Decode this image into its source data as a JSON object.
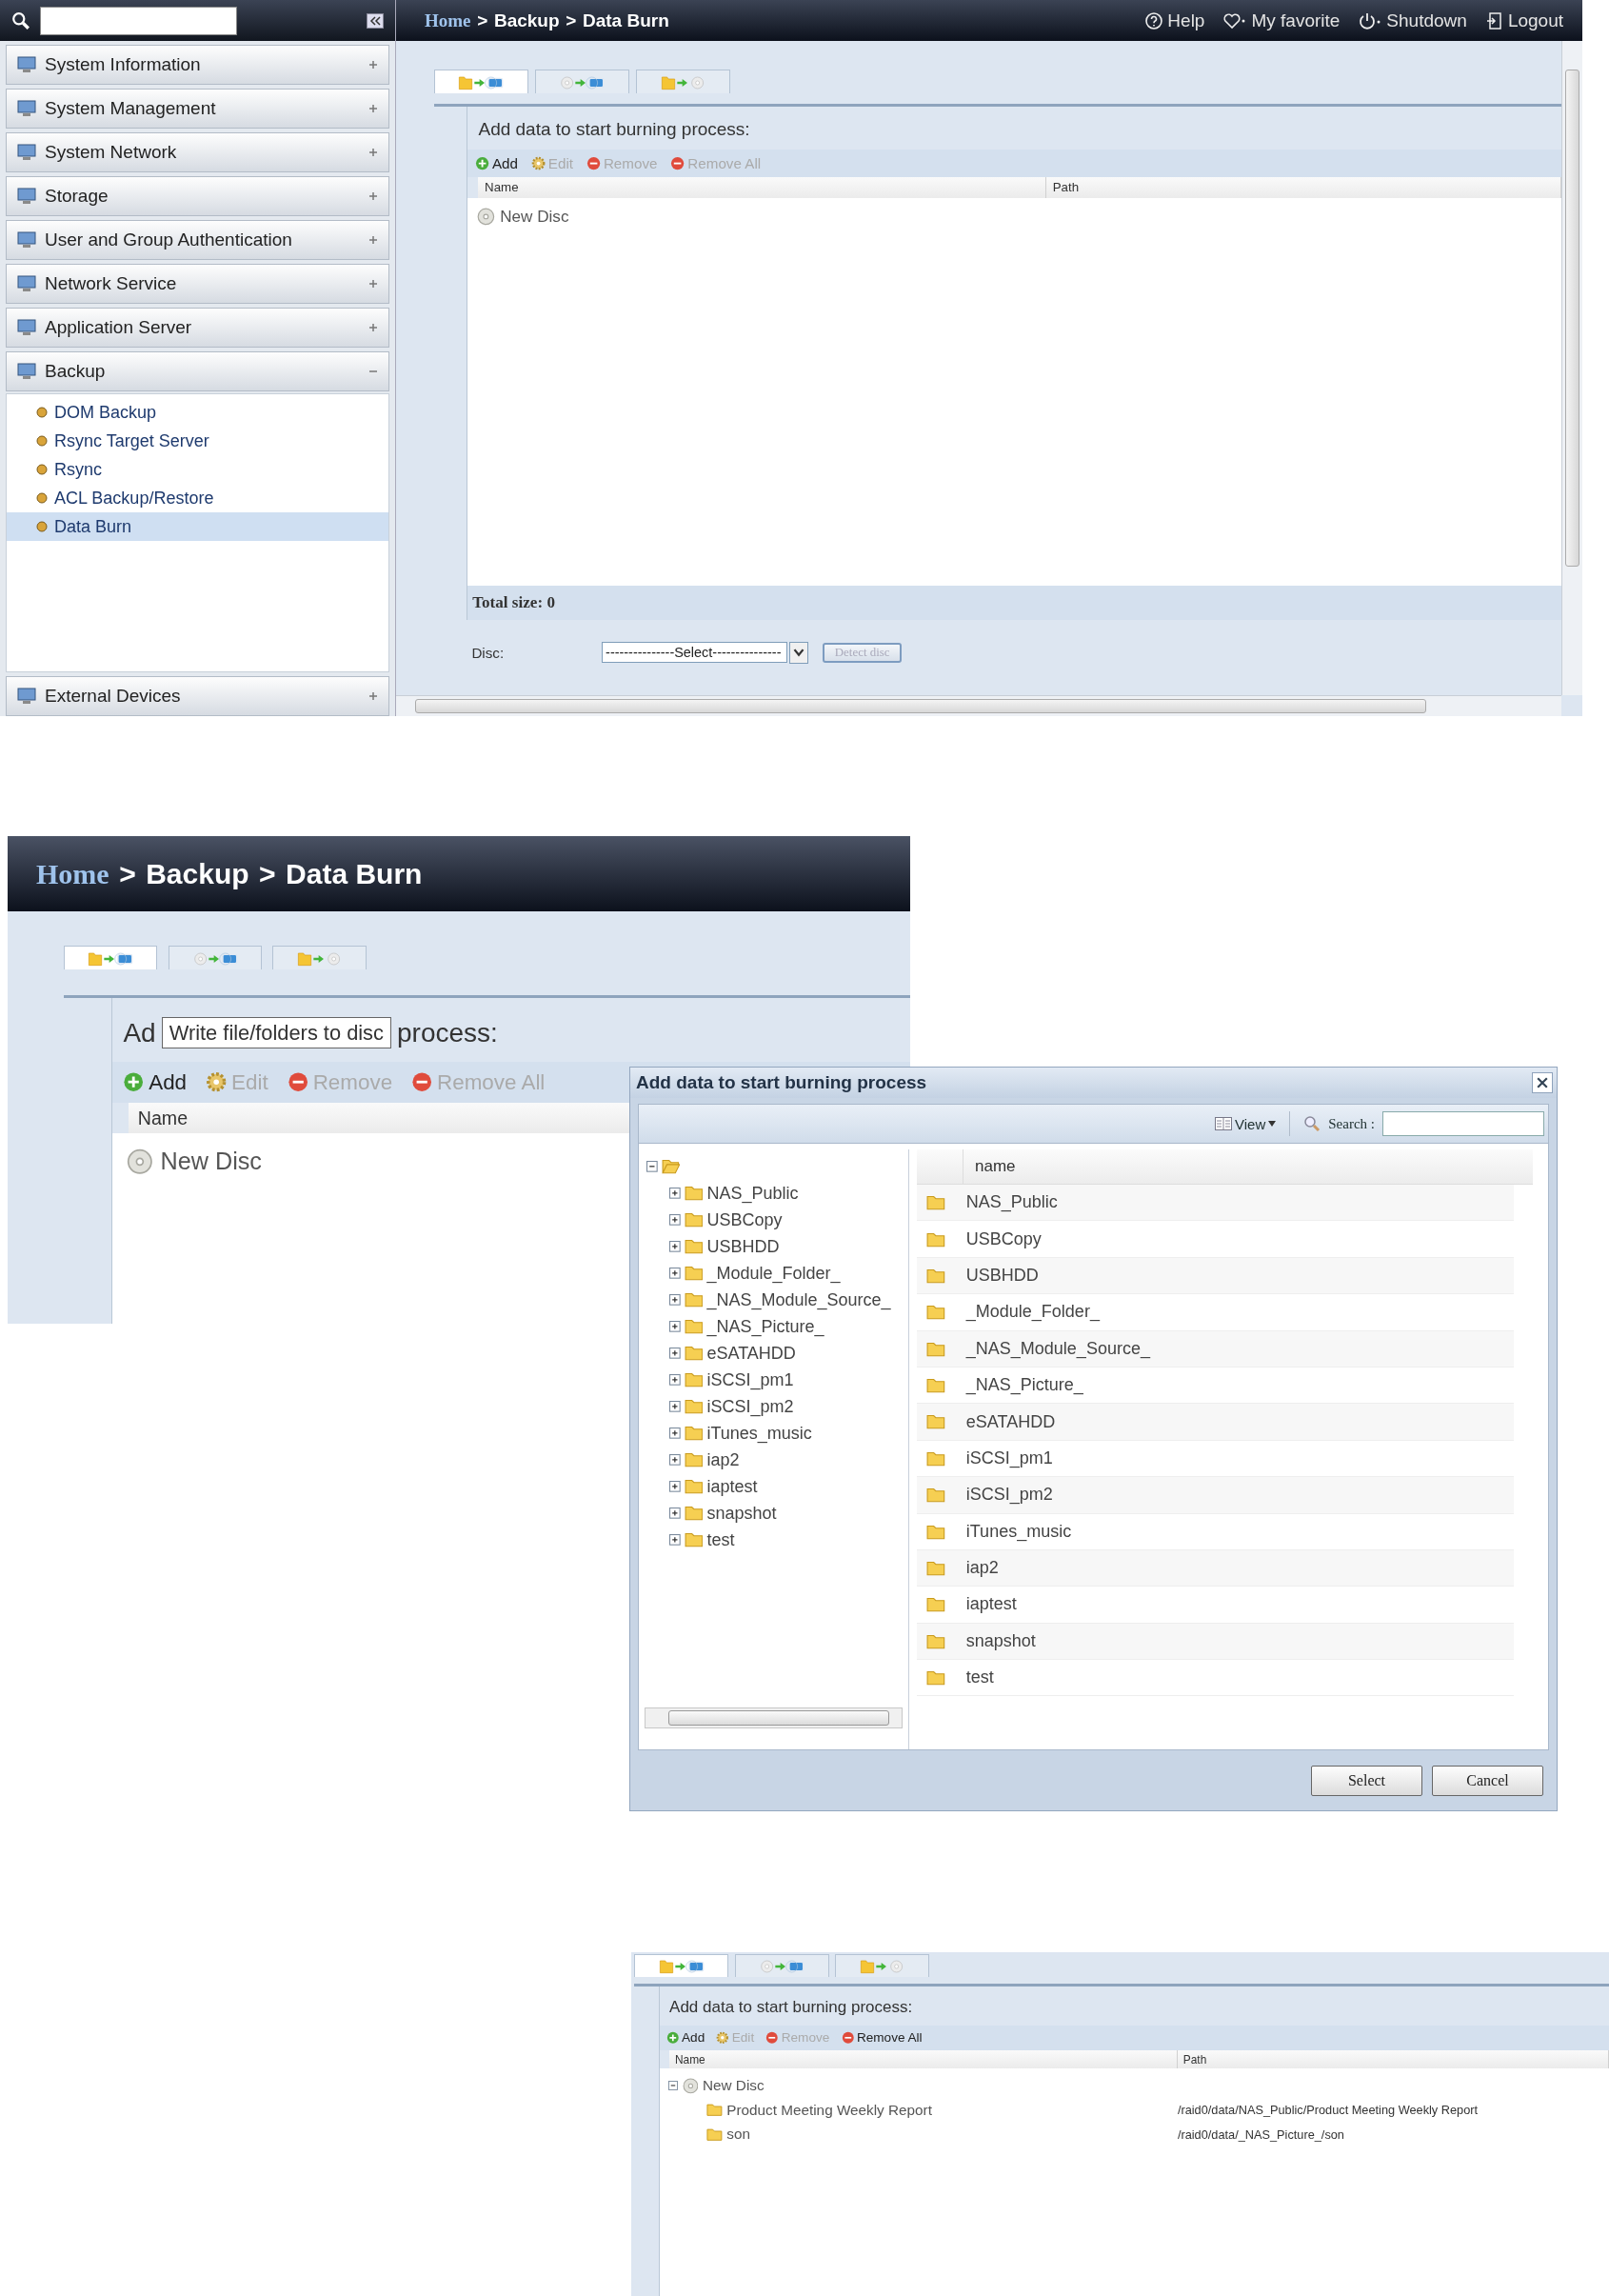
{
  "screen_1": {
    "sidebar": [
      {
        "label": "System Information",
        "expanded": false
      },
      {
        "label": "System Management",
        "expanded": false
      },
      {
        "label": "System Network",
        "expanded": false
      },
      {
        "label": "Storage",
        "expanded": false
      },
      {
        "label": "User and Group Authentication",
        "expanded": false
      },
      {
        "label": "Network Service",
        "expanded": false
      },
      {
        "label": "Application Server",
        "expanded": false
      },
      {
        "label": "Backup",
        "expanded": true,
        "children": [
          {
            "label": "DOM Backup",
            "selected": false
          },
          {
            "label": "Rsync Target Server",
            "selected": false
          },
          {
            "label": "Rsync",
            "selected": false
          },
          {
            "label": "ACL Backup/Restore",
            "selected": false
          },
          {
            "label": "Data Burn",
            "selected": true
          }
        ]
      },
      {
        "label": "External Devices",
        "expanded": false
      }
    ],
    "breadcrumb": [
      {
        "label": "Home",
        "kind": "link"
      },
      {
        "label": ">",
        "kind": "separator"
      },
      {
        "label": "Backup",
        "kind": "crumb"
      },
      {
        "label": ">",
        "kind": "separator"
      },
      {
        "label": "Data Burn",
        "kind": "crumb"
      }
    ],
    "top_links": [
      {
        "label": "Help",
        "kind": "help"
      },
      {
        "label": "My favorite",
        "kind": "favorite"
      },
      {
        "label": "Shutdown",
        "kind": "power"
      },
      {
        "label": "Logout",
        "kind": "logout"
      }
    ],
    "tabs": [
      {
        "kind": "folder-to-image",
        "selected": true
      },
      {
        "kind": "disc-to-image",
        "selected": false
      },
      {
        "kind": "folder-to-disc",
        "selected": false
      }
    ],
    "heading": "Add data to start burning process:",
    "toolbar": [
      {
        "label": "Add",
        "kind": "add",
        "disabled": false
      },
      {
        "label": "Edit",
        "kind": "edit",
        "disabled": true
      },
      {
        "label": "Remove",
        "kind": "remove",
        "disabled": true
      },
      {
        "label": "Remove All",
        "kind": "remove",
        "disabled": true
      }
    ],
    "columns": [
      "Name",
      "Path"
    ],
    "tree": [
      {
        "name": "New Disc",
        "kind": "disc"
      }
    ],
    "total": "Total size: 0",
    "disc_label": "Disc:",
    "disc_select": "---------------Select---------------",
    "detect_button": {
      "label": "Detect disc",
      "disabled": true
    }
  },
  "screen_2": {
    "breadcrumb": [
      {
        "label": "Home",
        "kind": "link"
      },
      {
        "label": ">",
        "kind": "separator"
      },
      {
        "label": "Backup",
        "kind": "crumb"
      },
      {
        "label": ">",
        "kind": "separator"
      },
      {
        "label": "Data Burn",
        "kind": "crumb"
      }
    ],
    "tabs": [
      {
        "kind": "folder-to-image",
        "selected": true
      },
      {
        "kind": "disc-to-image",
        "selected": false
      },
      {
        "kind": "folder-to-disc",
        "selected": false
      }
    ],
    "heading_parts": [
      "Ad",
      "process:"
    ],
    "tooltip": "Write file/folders to disc",
    "toolbar": [
      {
        "label": "Add",
        "kind": "add",
        "disabled": false
      },
      {
        "label": "Edit",
        "kind": "edit",
        "disabled": true
      },
      {
        "label": "Remove",
        "kind": "remove",
        "disabled": true
      },
      {
        "label": "Remove All",
        "kind": "remove",
        "disabled": true
      }
    ],
    "columns": [
      "Name"
    ],
    "tree": [
      {
        "name": "New Disc",
        "kind": "disc"
      }
    ],
    "dialog": {
      "title": "Add data to start burning process",
      "view": "View",
      "search_label": "Search :",
      "tree": {
        "expanded": true,
        "children": [
          {
            "name": "NAS_Public",
            "expanded": false
          },
          {
            "name": "USBCopy",
            "expanded": false
          },
          {
            "name": "USBHDD",
            "expanded": false
          },
          {
            "name": "_Module_Folder_",
            "expanded": false
          },
          {
            "name": "_NAS_Module_Source_",
            "expanded": false
          },
          {
            "name": "_NAS_Picture_",
            "expanded": false
          },
          {
            "name": "eSATAHDD",
            "expanded": false
          },
          {
            "name": "iSCSI_pm1",
            "expanded": false
          },
          {
            "name": "iSCSI_pm2",
            "expanded": false
          },
          {
            "name": "iTunes_music",
            "expanded": false
          },
          {
            "name": "iap2",
            "expanded": false
          },
          {
            "name": "iaptest",
            "expanded": false
          },
          {
            "name": "snapshot",
            "expanded": false
          },
          {
            "name": "test",
            "expanded": false
          }
        ]
      },
      "list_column": "name",
      "rows": [
        "NAS_Public",
        "USBCopy",
        "USBHDD",
        "_Module_Folder_",
        "_NAS_Module_Source_",
        "_NAS_Picture_",
        "eSATAHDD",
        "iSCSI_pm1",
        "iSCSI_pm2",
        "iTunes_music",
        "iap2",
        "iaptest",
        "snapshot",
        "test"
      ],
      "buttons": [
        "Select",
        "Cancel"
      ]
    }
  },
  "screen_3": {
    "tabs": [
      {
        "kind": "folder-to-image",
        "selected": true
      },
      {
        "kind": "disc-to-image",
        "selected": false
      },
      {
        "kind": "folder-to-disc",
        "selected": false
      }
    ],
    "heading": "Add data to start burning process:",
    "toolbar": [
      {
        "label": "Add",
        "kind": "add",
        "disabled": false
      },
      {
        "label": "Edit",
        "kind": "edit",
        "disabled": true
      },
      {
        "label": "Remove",
        "kind": "remove",
        "disabled": true
      },
      {
        "label": "Remove All",
        "kind": "remove",
        "disabled": false
      }
    ],
    "columns": [
      "Name",
      "Path"
    ],
    "tree": [
      {
        "name": "New Disc",
        "kind": "disc",
        "expanded": true,
        "children": [
          {
            "name": "Product Meeting Weekly Report",
            "kind": "folder",
            "path": "/raid0/data/NAS_Public/Product Meeting Weekly Report"
          },
          {
            "name": "son",
            "kind": "folder",
            "path": "/raid0/data/_NAS_Picture_/son"
          }
        ]
      }
    ]
  }
}
